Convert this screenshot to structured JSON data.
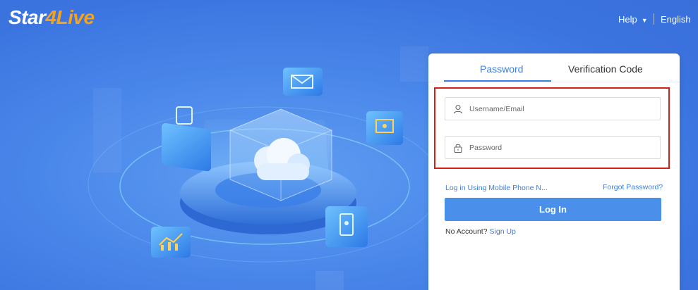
{
  "header": {
    "logo_part1": "Star",
    "logo_part2": "4Live",
    "help_label": "Help",
    "language_label": "English"
  },
  "login": {
    "tabs": [
      {
        "label": "Password",
        "active": true
      },
      {
        "label": "Verification Code",
        "active": false
      }
    ],
    "username_placeholder": "Username/Email",
    "password_placeholder": "Password",
    "mobile_login_link": "Log in Using Mobile Phone N...",
    "forgot_password_link": "Forgot Password?",
    "login_button": "Log In",
    "no_account_text": "No Account?",
    "sign_up_link": "Sign Up"
  },
  "colors": {
    "accent": "#3d7fe0",
    "button": "#4a90ea",
    "logo_orange": "#f7a21a",
    "highlight_border": "#d0221b"
  }
}
